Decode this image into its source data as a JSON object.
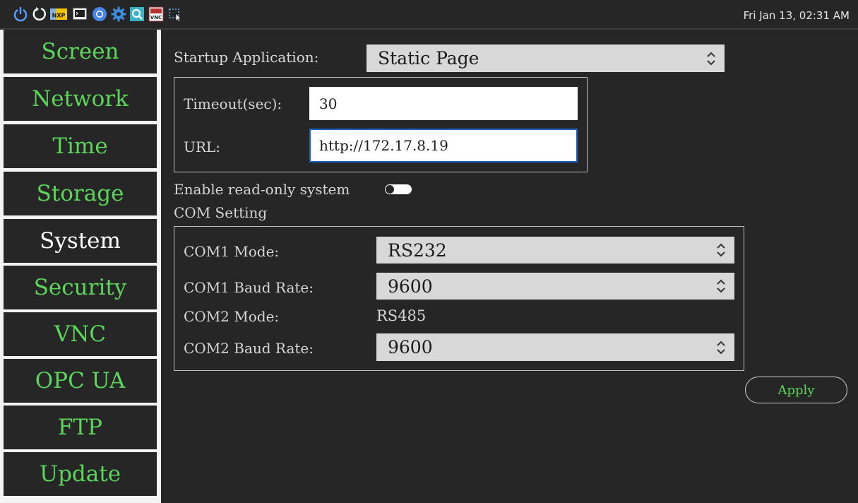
{
  "taskbar": {
    "icons": [
      "power-icon",
      "restart-icon",
      "nxp-icon",
      "terminal-icon",
      "chromium-icon",
      "settings-gear-icon",
      "search-icon",
      "tightvnc-icon",
      "screenshot-selection-icon"
    ],
    "clock": "Fri Jan 13, 02:31 AM",
    "nxp_text": "NXP",
    "vnc_text": "VNC"
  },
  "sidebar": {
    "active": "System",
    "items": [
      {
        "label": "Screen"
      },
      {
        "label": "Network"
      },
      {
        "label": "Time"
      },
      {
        "label": "Storage"
      },
      {
        "label": "System"
      },
      {
        "label": "Security"
      },
      {
        "label": "VNC"
      },
      {
        "label": "OPC UA"
      },
      {
        "label": "FTP"
      },
      {
        "label": "Update"
      }
    ]
  },
  "system": {
    "startup_label": "Startup Application:",
    "startup_value": "Static Page",
    "timeout_label": "Timeout(sec):",
    "timeout_value": "30",
    "url_label": "URL:",
    "url_value": "http://172.17.8.19",
    "readonly_label": "Enable read-only system",
    "readonly_enabled": false,
    "com_heading": "COM Setting",
    "com1_mode_label": "COM1 Mode:",
    "com1_mode_value": "RS232",
    "com1_baud_label": "COM1 Baud Rate:",
    "com1_baud_value": "9600",
    "com2_mode_label": "COM2 Mode:",
    "com2_mode_value": "RS485",
    "com2_baud_label": "COM2 Baud Rate:",
    "com2_baud_value": "9600",
    "apply_label": "Apply"
  },
  "colors": {
    "panel_bg": "#262626",
    "accent_green": "#5bd65b",
    "focus_blue": "#1e62c8"
  }
}
